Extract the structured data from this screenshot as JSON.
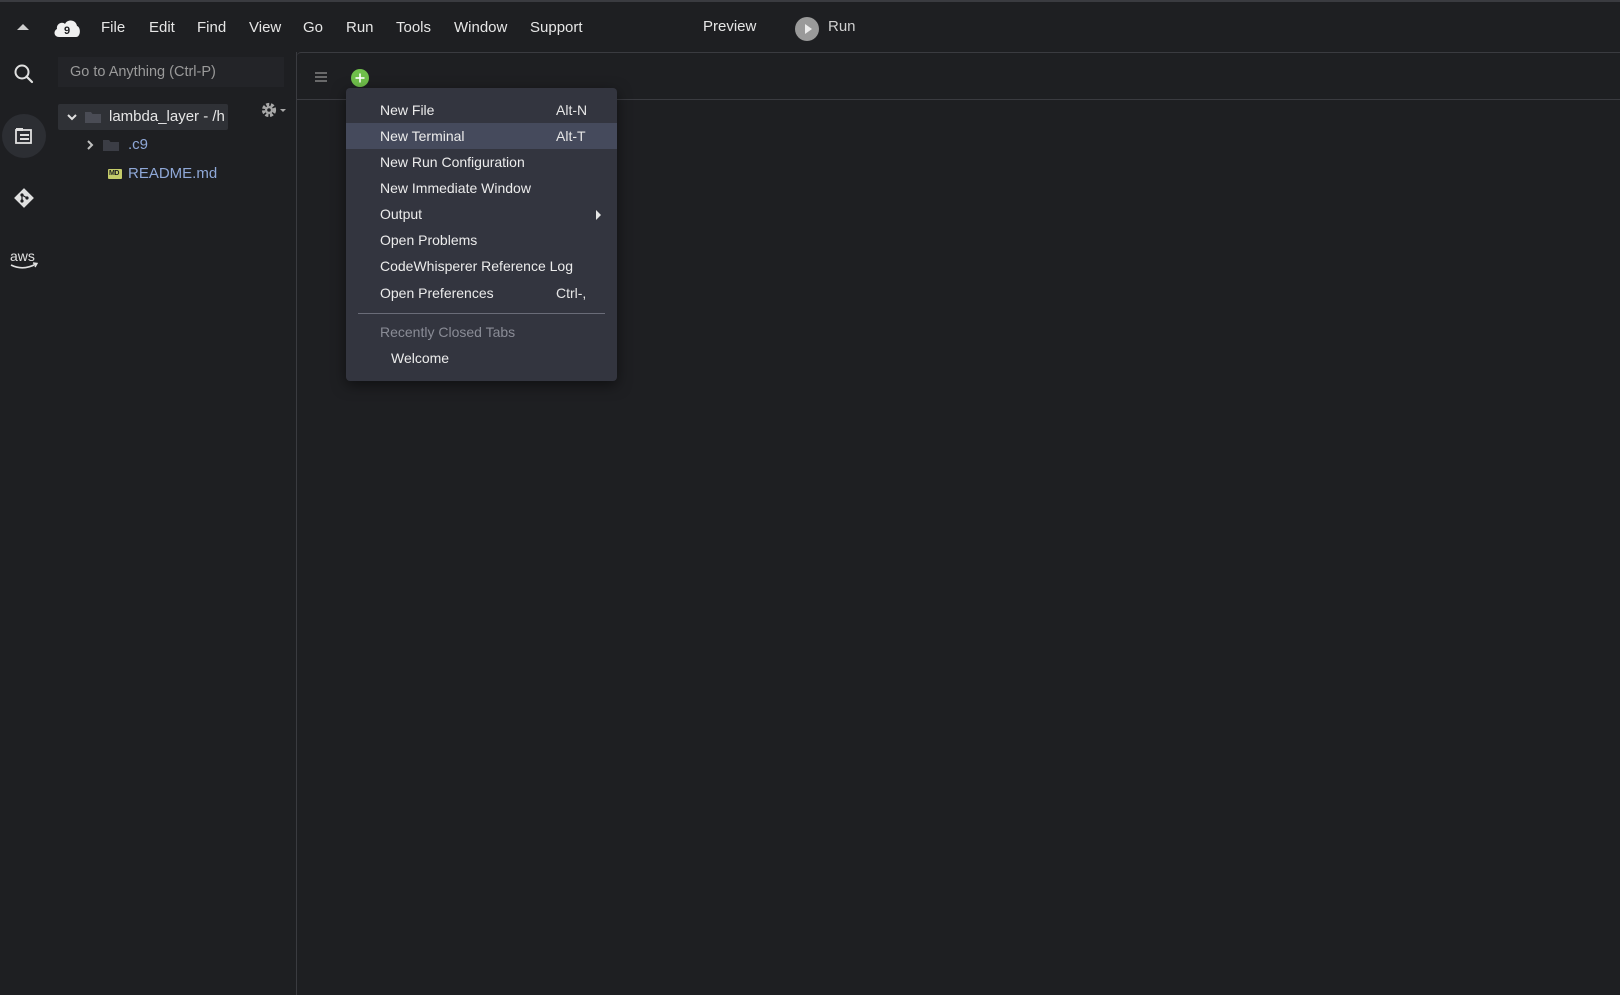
{
  "menubar": {
    "items": [
      "File",
      "Edit",
      "Find",
      "View",
      "Go",
      "Run",
      "Tools",
      "Window",
      "Support"
    ],
    "preview_label": "Preview",
    "run_label": "Run"
  },
  "activity_bar": {
    "icons": [
      "search-icon",
      "explorer-icon",
      "source-control-icon",
      "aws-icon"
    ],
    "aws_text": "aws"
  },
  "file_tree": {
    "goto_placeholder": "Go to Anything (Ctrl-P)",
    "root_label": "lambda_layer - /h",
    "items": [
      {
        "label": ".c9",
        "type": "folder"
      },
      {
        "label": "README.md",
        "type": "markdown-file",
        "badge": "MD"
      }
    ]
  },
  "new_tab_menu": {
    "items": [
      {
        "label": "New File",
        "shortcut": "Alt-N"
      },
      {
        "label": "New Terminal",
        "shortcut": "Alt-T",
        "highlighted": true
      },
      {
        "label": "New Run Configuration",
        "shortcut": ""
      },
      {
        "label": "New Immediate Window",
        "shortcut": ""
      },
      {
        "label": "Output",
        "shortcut": "",
        "submenu": true
      },
      {
        "label": "Open Problems",
        "shortcut": ""
      },
      {
        "label": "CodeWhisperer Reference Log",
        "shortcut": ""
      },
      {
        "label": "Open Preferences",
        "shortcut": "Ctrl-,"
      }
    ],
    "recent_heading": "Recently Closed Tabs",
    "recent_items": [
      "Welcome"
    ]
  },
  "colors": {
    "background": "#1e1f22",
    "menu_bg": "#33353f",
    "menu_highlight": "#454a5c",
    "add_tab_green": "#6fbf4a"
  }
}
